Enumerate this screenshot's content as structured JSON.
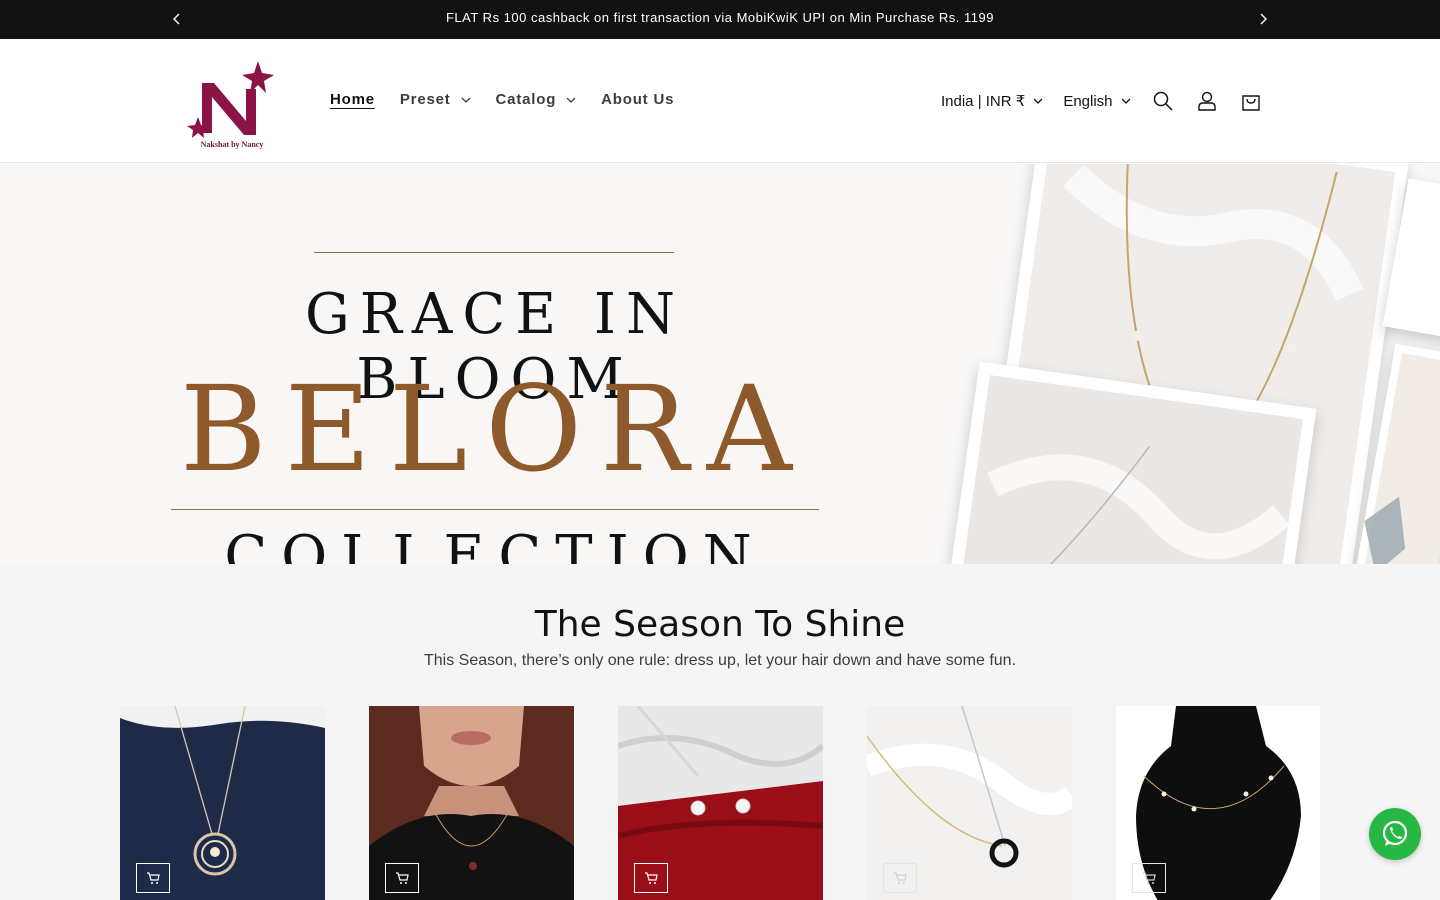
{
  "announcement": {
    "message": "FLAT Rs 100 cashback on first transaction via MobiKwiK UPI on Min Purchase Rs. 1199"
  },
  "header": {
    "logo_text": "Nakshat by Nancy",
    "nav": [
      {
        "label": "Home",
        "active": true,
        "has_dropdown": false
      },
      {
        "label": "Preset",
        "active": false,
        "has_dropdown": true
      },
      {
        "label": "Catalog",
        "active": false,
        "has_dropdown": true
      },
      {
        "label": "About Us",
        "active": false,
        "has_dropdown": false
      }
    ],
    "country_selector": "India | INR ₹",
    "language_selector": "English"
  },
  "hero": {
    "subtitle": "GRACE IN BLOOM",
    "title": "BELORA",
    "tagline": "COLLECTION",
    "accent_color": "#8e5a2c"
  },
  "section": {
    "heading": "The Season To Shine",
    "subheading": "This Season, there’s only one rule: dress up, let your hair down and have some fun."
  },
  "products": [
    {
      "name": "Spiral pendant necklace on navy velvet",
      "icon": "cart-plus-icon"
    },
    {
      "name": "Heart pendant necklace on model",
      "icon": "cart-plus-icon"
    },
    {
      "name": "Flower stud earrings on marble",
      "icon": "cart-plus-icon"
    },
    {
      "name": "Black stone pendant necklace on white cloth",
      "icon": "cart-plus-icon"
    },
    {
      "name": "Pearl station necklace on black bust",
      "icon": "cart-plus-icon"
    }
  ],
  "colors": {
    "announcement_bg": "#121212",
    "whatsapp": "#26b744",
    "logo": "#8b1345"
  }
}
